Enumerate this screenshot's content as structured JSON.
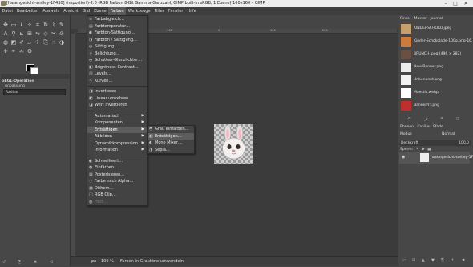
{
  "window": {
    "title": "[hasengesicht-smiley-1F430] (importiert)-2.0 (RGB Farben 8-Bit Gamma-Ganzzahl, GIMP built-in sRGB, 1 Ebene) 160x160 – GIMP",
    "minimize": "–",
    "maximize": "□",
    "close": "✕"
  },
  "menubar": {
    "items": [
      "Datei",
      "Bearbeiten",
      "Auswahl",
      "Ansicht",
      "Bild",
      "Ebene",
      "Farben",
      "Werkzeuge",
      "Filter",
      "Fenster",
      "Hilfe"
    ],
    "active": "Farben"
  },
  "toolbox": {
    "options_title": "GEGL-Operation",
    "options_subtitle": "Anpassung",
    "field_value": "Radius"
  },
  "farben_menu": {
    "items": [
      {
        "label": "Farbabgleich…",
        "icon": "≡"
      },
      {
        "label": "Farbtemperatur…",
        "icon": "▤"
      },
      {
        "label": "Farbton-Sättigung…",
        "icon": "◐"
      },
      {
        "label": "Farbton / Sättigung…",
        "icon": "◑"
      },
      {
        "label": "Sättigung…",
        "icon": "◒"
      },
      {
        "label": "Belichtung…",
        "icon": "☀"
      },
      {
        "label": "Schatten-Glanzlichter…",
        "icon": "◓"
      },
      {
        "label": "Brightness-Contrast…",
        "icon": "◧"
      },
      {
        "label": "Levels…",
        "icon": "▥"
      },
      {
        "label": "Kurven…",
        "icon": "∿"
      },
      {
        "label": "Invertieren",
        "icon": "◨"
      },
      {
        "label": "Linear umkehren",
        "icon": "◩"
      },
      {
        "label": "Wert invertieren",
        "icon": "◪"
      },
      {
        "label": "Automatisch",
        "icon": ""
      },
      {
        "label": "Komponenten",
        "icon": ""
      },
      {
        "label": "Entsättigen",
        "icon": ""
      },
      {
        "label": "Abbilden",
        "icon": ""
      },
      {
        "label": "Dynamikkompression",
        "icon": ""
      },
      {
        "label": "Information",
        "icon": ""
      },
      {
        "label": "Schwellwert…",
        "icon": "◐"
      },
      {
        "label": "Einfärben …",
        "icon": "◓"
      },
      {
        "label": "Posterisieren…",
        "icon": "▦"
      },
      {
        "label": "Farbe nach Alpha…",
        "icon": "◌"
      },
      {
        "label": "Dithern…",
        "icon": "▩"
      },
      {
        "label": "RGB Clip…",
        "icon": "◫"
      },
      {
        "label": "Heiß…",
        "icon": "◍"
      }
    ]
  },
  "entsaettigen_submenu": {
    "items": [
      {
        "label": "Grau einfärben…",
        "icon": "◓"
      },
      {
        "label": "Entsättigen…",
        "icon": "◧"
      },
      {
        "label": "Mono Mixer…",
        "icon": "◐"
      },
      {
        "label": "Sepia…",
        "icon": "◑"
      }
    ]
  },
  "statusbar": {
    "unit": "px",
    "zoom": "100 %",
    "message": "Farben in Grautöne umwandeln"
  },
  "rightpanel": {
    "tabs": [
      "Pinsel",
      "Muster",
      "Journal"
    ],
    "documents": [
      {
        "label": "KINDERSCHOKO.jpeg",
        "color": "#c8a070"
      },
      {
        "label": "Kinder-Schokolade-100g.png-16…",
        "color": "#d07a3a"
      },
      {
        "label": "BRUNCH.jpeg (496 × 282)",
        "color": "#6a5040"
      },
      {
        "label": "New-Banner.png",
        "color": "#ececec"
      },
      {
        "label": "Unbenannt.png",
        "color": "#f2f2f2"
      },
      {
        "label": "Maestic.webp",
        "color": "#ffffff"
      },
      {
        "label": "Banner-YT.png",
        "color": "#c0302a"
      }
    ],
    "layer_tabs": [
      "Ebenen",
      "Kanäle",
      "Pfade"
    ],
    "mode_label": "Modus",
    "mode_value": "Normal",
    "opacity_label": "Deckkraft",
    "opacity_value": "100,0",
    "lock_label": "Sperre:",
    "layer_name": "hasengesicht-smiley-1F4…"
  },
  "ruler_ticks": [
    "-100",
    "0",
    "100",
    "200"
  ]
}
